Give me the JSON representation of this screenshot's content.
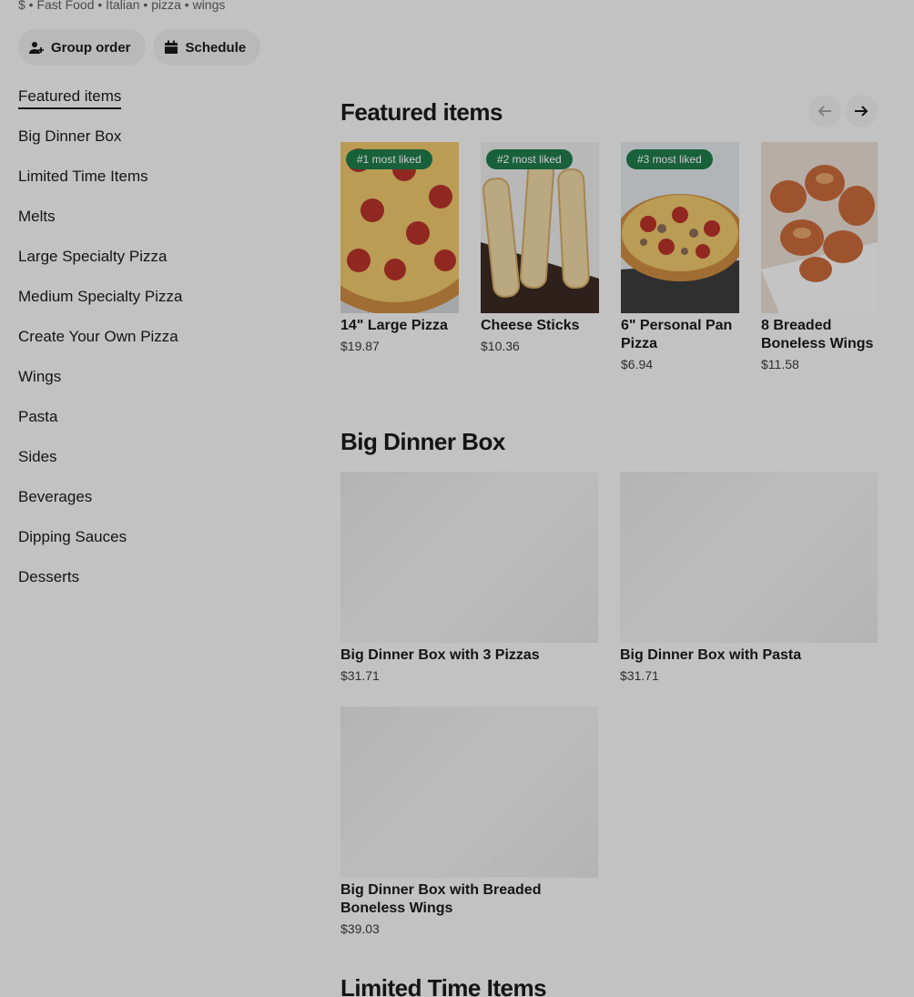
{
  "store": {
    "subline": "$ • Fast Food • Italian • pizza • wings"
  },
  "actions": {
    "group_order": "Group order",
    "schedule": "Schedule"
  },
  "sidebar": {
    "items": [
      {
        "label": "Featured items",
        "active": true
      },
      {
        "label": "Big Dinner Box"
      },
      {
        "label": "Limited Time Items"
      },
      {
        "label": "Melts"
      },
      {
        "label": "Large Specialty Pizza"
      },
      {
        "label": "Medium Specialty Pizza"
      },
      {
        "label": "Create Your Own Pizza"
      },
      {
        "label": "Wings"
      },
      {
        "label": "Pasta"
      },
      {
        "label": "Sides"
      },
      {
        "label": "Beverages"
      },
      {
        "label": "Dipping Sauces"
      },
      {
        "label": "Desserts"
      }
    ]
  },
  "featured": {
    "title": "Featured items",
    "items": [
      {
        "badge": "#1 most liked",
        "name": "14\" Large Pizza",
        "price": "$19.87",
        "image": "pepperoni-pizza"
      },
      {
        "badge": "#2 most liked",
        "name": "Cheese Sticks",
        "price": "$10.36",
        "image": "cheese-sticks"
      },
      {
        "badge": "#3 most liked",
        "name": "6\" Personal Pan Pizza",
        "price": "$6.94",
        "image": "pan-pizza"
      },
      {
        "name": "8 Breaded Boneless Wings",
        "price": "$11.58",
        "image": "boneless-wings"
      }
    ]
  },
  "big_dinner_box": {
    "title": "Big Dinner Box",
    "items": [
      {
        "name": "Big Dinner Box with 3 Pizzas",
        "price": "$31.71"
      },
      {
        "name": "Big Dinner Box with Pasta",
        "price": "$31.71"
      },
      {
        "name": "Big Dinner Box with Breaded Boneless Wings",
        "price": "$39.03"
      }
    ]
  },
  "limited_time": {
    "title": "Limited Time Items"
  },
  "colors": {
    "badge": "#1f7a4a",
    "background": "#f3f3f3"
  }
}
